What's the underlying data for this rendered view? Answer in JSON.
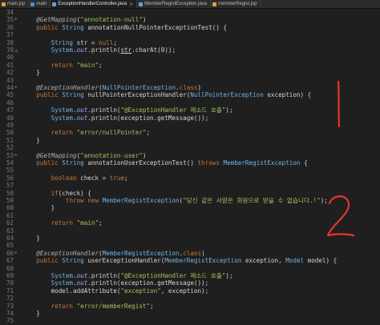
{
  "tabs": [
    {
      "label": "main.jsp",
      "icon": "jsp-file-icon",
      "active": false
    },
    {
      "label": "main",
      "icon": "browser-icon",
      "active": false
    },
    {
      "label": "ExceptionHandlerController.java",
      "icon": "java-file-icon",
      "active": true
    },
    {
      "label": "MemberRegistException.java",
      "icon": "java-file-icon",
      "active": false
    },
    {
      "label": "memberRegist.jsp",
      "icon": "jsp-file-icon",
      "active": false
    }
  ],
  "lines": [
    {
      "n": "34",
      "html": ""
    },
    {
      "n": "35",
      "fold": true,
      "html": "    <span class='ann'>@GetMapping</span>(<span class='str'>\"annotation-null\"</span>)"
    },
    {
      "n": "36",
      "html": "    <span class='kw'>public</span> <span class='ty'>String</span> annotationNullPointerExceptionTest() {"
    },
    {
      "n": "37",
      "html": ""
    },
    {
      "n": "38",
      "html": "        <span class='ty'>String</span> str = <span class='kw'>null</span>;"
    },
    {
      "n": "39",
      "warn": true,
      "html": "        <span class='ty'>System</span>.<span class='fld'>out</span>.println(<u>str</u>.charAt(0));"
    },
    {
      "n": "40",
      "html": ""
    },
    {
      "n": "41",
      "html": "        <span class='kw'>return</span> <span class='str'>\"main\"</span>;"
    },
    {
      "n": "42",
      "html": "    }"
    },
    {
      "n": "43",
      "html": ""
    },
    {
      "n": "44",
      "fold": true,
      "html": "    <span class='ann'>@ExceptionHandler</span>(<span class='ty'>NullPointerException</span>.<span class='kw'>class</span>)"
    },
    {
      "n": "45",
      "html": "    <span class='kw'>public</span> <span class='ty'>String</span> nullPointerExceptionHandler(<span class='ty'>NullPointerException</span> exception) {"
    },
    {
      "n": "46",
      "html": ""
    },
    {
      "n": "47",
      "html": "        <span class='ty'>System</span>.<span class='fld'>out</span>.println(<span class='str'>\"@ExceptionHandler 메소드 호출\"</span>);"
    },
    {
      "n": "48",
      "html": "        <span class='ty'>System</span>.<span class='fld'>out</span>.println(exception.getMessage());"
    },
    {
      "n": "49",
      "html": ""
    },
    {
      "n": "50",
      "html": "        <span class='kw'>return</span> <span class='str'>\"error/nullPointer\"</span>;"
    },
    {
      "n": "51",
      "html": "    }"
    },
    {
      "n": "52",
      "html": ""
    },
    {
      "n": "53",
      "fold": true,
      "html": "    <span class='ann'>@GetMapping</span>(<span class='str'>\"annotation-user\"</span>)"
    },
    {
      "n": "54",
      "html": "    <span class='kw'>public</span> <span class='ty'>String</span> annotationUserExceptionTest() <span class='kw'>throws</span> <span class='ty'>MemberRegistException</span> {"
    },
    {
      "n": "55",
      "html": ""
    },
    {
      "n": "56",
      "html": "        <span class='kw'>boolean</span> check = <span class='kw'>true</span>;"
    },
    {
      "n": "57",
      "html": ""
    },
    {
      "n": "58",
      "html": "        <span class='kw'>if</span>(check) {"
    },
    {
      "n": "59",
      "html": "            <span class='kw'>throw</span> <span class='kw'>new</span> <span class='ty'>MemberRegistException</span>(<span class='str'>\"당신 같은 사람은 회원으로 받을 수 없습니다.!\"</span>);"
    },
    {
      "n": "60",
      "html": "        }"
    },
    {
      "n": "61",
      "html": ""
    },
    {
      "n": "62",
      "html": "        <span class='kw'>return</span> <span class='str'>\"main\"</span>;"
    },
    {
      "n": "63",
      "html": ""
    },
    {
      "n": "64",
      "html": "    }"
    },
    {
      "n": "65",
      "html": ""
    },
    {
      "n": "66",
      "fold": true,
      "html": "    <span class='ann'>@ExceptionHandler</span>(<span class='ty'>MemberRegistException</span>.<span class='kw'>class</span>)"
    },
    {
      "n": "67",
      "html": "    <span class='kw'>public</span> <span class='ty'>String</span> userExceptionHandler(<span class='ty'>MemberRegistException</span> exception, <span class='ty'>Model</span> model) {"
    },
    {
      "n": "68",
      "html": ""
    },
    {
      "n": "69",
      "html": "        <span class='ty'>System</span>.<span class='fld'>out</span>.println(<span class='str'>\"@ExceptionHandler 메소드 호출\"</span>);"
    },
    {
      "n": "70",
      "html": "        <span class='ty'>System</span>.<span class='fld'>out</span>.println(exception.getMessage());"
    },
    {
      "n": "71",
      "html": "        model.addAttribute(<span class='str'>\"exception\"</span>, exception);"
    },
    {
      "n": "72",
      "html": ""
    },
    {
      "n": "73",
      "html": "        <span class='kw'>return</span> <span class='str'>\"error/memberRegist\"</span>;"
    },
    {
      "n": "74",
      "html": "    }"
    },
    {
      "n": "75",
      "html": ""
    }
  ],
  "annotations": {
    "mark_1": "1",
    "mark_2": "2",
    "color": "#e5362b"
  }
}
